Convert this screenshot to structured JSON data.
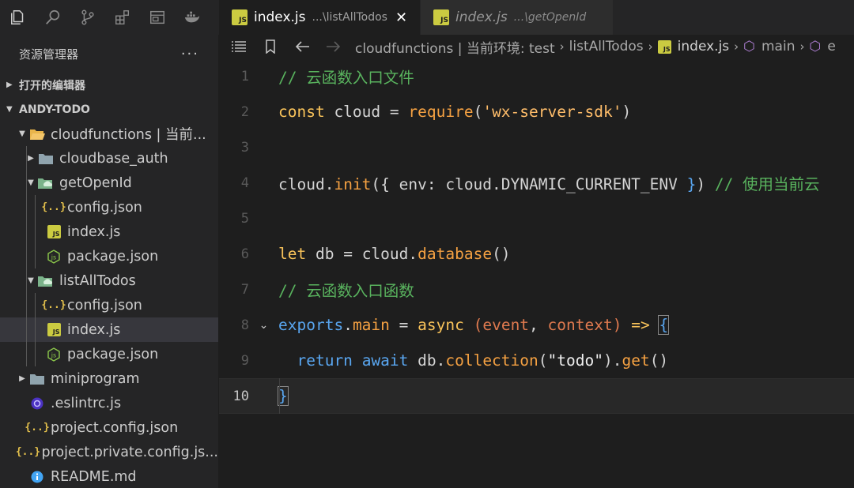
{
  "activity_bar": {
    "icons": [
      "explorer-icon",
      "search-icon",
      "source-control-icon",
      "extensions-icon",
      "remote-explorer-icon",
      "docker-icon"
    ]
  },
  "sidebar": {
    "title": "资源管理器",
    "more": "···",
    "open_editors": "打开的编辑器",
    "project": "ANDY-TODO",
    "tree": [
      {
        "label": "cloudfunctions | 当前...",
        "depth": 1,
        "kind": "folder-open",
        "twist": "open"
      },
      {
        "label": "cloudbase_auth",
        "depth": 2,
        "kind": "folder",
        "twist": "closed"
      },
      {
        "label": "getOpenId",
        "depth": 2,
        "kind": "cloud-folder",
        "twist": "open"
      },
      {
        "label": "config.json",
        "depth": 3,
        "kind": "json"
      },
      {
        "label": "index.js",
        "depth": 3,
        "kind": "js"
      },
      {
        "label": "package.json",
        "depth": 3,
        "kind": "npm"
      },
      {
        "label": "listAllTodos",
        "depth": 2,
        "kind": "cloud-folder",
        "twist": "open"
      },
      {
        "label": "config.json",
        "depth": 3,
        "kind": "json"
      },
      {
        "label": "index.js",
        "depth": 3,
        "kind": "js",
        "selected": true
      },
      {
        "label": "package.json",
        "depth": 3,
        "kind": "npm"
      },
      {
        "label": "miniprogram",
        "depth": 1,
        "kind": "folder",
        "twist": "closed"
      },
      {
        "label": ".eslintrc.js",
        "depth": 1,
        "kind": "eslint"
      },
      {
        "label": "project.config.json",
        "depth": 1,
        "kind": "json"
      },
      {
        "label": "project.private.config.js...",
        "depth": 1,
        "kind": "json"
      },
      {
        "label": "README.md",
        "depth": 1,
        "kind": "info"
      }
    ]
  },
  "tabs": [
    {
      "name": "index.js",
      "desc": "...\\listAllTodos",
      "close": "✕",
      "active": true
    },
    {
      "name": "index.js",
      "desc": "...\\getOpenId",
      "active": false
    }
  ],
  "breadcrumbs": {
    "path": "cloudfunctions | 当前环境: test",
    "folder": "listAllTodos",
    "file": "index.js",
    "symbol": "main",
    "more": "e"
  },
  "editor": {
    "current_line": 10,
    "lines": [
      {
        "n": "1",
        "tokens": [
          [
            "t-cm",
            "// 云函数入口文件"
          ]
        ]
      },
      {
        "n": "2",
        "tokens": [
          [
            "t-kw",
            "const"
          ],
          [
            "t-def",
            " cloud "
          ],
          [
            "t-op",
            "="
          ],
          [
            "t-def",
            " "
          ],
          [
            "t-fn",
            "require"
          ],
          [
            "t-def",
            "("
          ],
          [
            "t-strq",
            "'wx-server-sdk'"
          ],
          [
            "t-def",
            ")"
          ]
        ]
      },
      {
        "n": "3",
        "tokens": []
      },
      {
        "n": "4",
        "tokens": [
          [
            "t-def",
            "cloud."
          ],
          [
            "t-fn",
            "init"
          ],
          [
            "t-def",
            "({ env: cloud.DYNAMIC_CURRENT_ENV "
          ],
          [
            "t-brace",
            "}"
          ],
          [
            "t-def",
            ") "
          ],
          [
            "t-cm",
            "// 使用当前云"
          ]
        ]
      },
      {
        "n": "5",
        "tokens": []
      },
      {
        "n": "6",
        "tokens": [
          [
            "t-kw",
            "let"
          ],
          [
            "t-def",
            " db "
          ],
          [
            "t-op",
            "="
          ],
          [
            "t-def",
            " cloud."
          ],
          [
            "t-fn",
            "database"
          ],
          [
            "t-def",
            "()"
          ]
        ]
      },
      {
        "n": "7",
        "tokens": [
          [
            "t-cm",
            "// 云函数入口函数"
          ]
        ]
      },
      {
        "n": "8",
        "tokens": [
          [
            "t-kw2",
            "exports"
          ],
          [
            "t-def",
            "."
          ],
          [
            "t-fn",
            "main"
          ],
          [
            "t-def",
            " = "
          ],
          [
            "t-kw",
            "async"
          ],
          [
            "t-def",
            " "
          ],
          [
            "t-param",
            "("
          ],
          [
            "t-param",
            "event"
          ],
          [
            "t-def",
            ", "
          ],
          [
            "t-param",
            "context"
          ],
          [
            "t-param",
            ")"
          ],
          [
            "t-def",
            " "
          ],
          [
            "t-kw",
            "=>"
          ],
          [
            "t-def",
            " "
          ],
          [
            "t-brace",
            "{"
          ]
        ]
      },
      {
        "n": "9",
        "tokens": [
          [
            "t-def",
            "  "
          ],
          [
            "t-kw2",
            "return"
          ],
          [
            "t-def",
            " "
          ],
          [
            "t-kw2",
            "await"
          ],
          [
            "t-def",
            " db."
          ],
          [
            "t-fn",
            "collection"
          ],
          [
            "t-def",
            "("
          ],
          [
            "t-str",
            "\"todo\""
          ],
          [
            "t-def",
            ")."
          ],
          [
            "t-fn",
            "get"
          ],
          [
            "t-def",
            "()"
          ]
        ]
      },
      {
        "n": "10",
        "tokens": [
          [
            "t-brace",
            "}"
          ]
        ]
      }
    ]
  }
}
